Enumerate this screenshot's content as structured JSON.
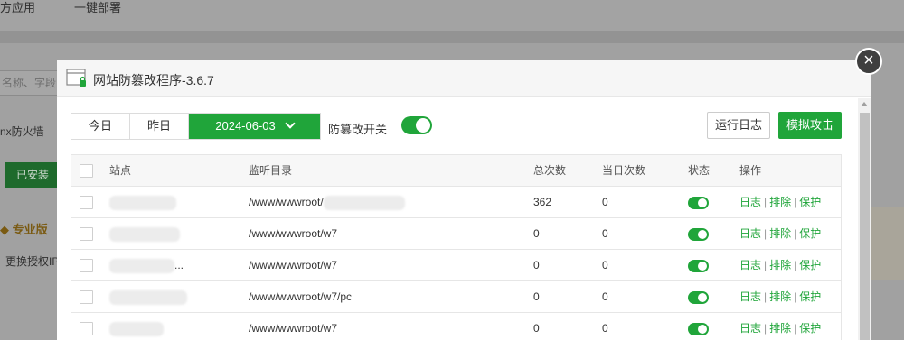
{
  "background": {
    "tabs": [
      "方应用",
      "一键部署"
    ],
    "search_placeholder": "名称、字段",
    "firewall_label": "nx防火墙",
    "installed_label": "已安装",
    "pro_label": "专业版",
    "ip_label": "更换授权IP"
  },
  "dialog": {
    "title": "网站防篡改程序-3.6.7",
    "close_icon": "close-icon",
    "date_buttons": {
      "today": "今日",
      "yesterday": "昨日",
      "selected_date": "2024-06-03"
    },
    "toggle_label": "防篡改开关",
    "toggle_on": true,
    "run_log_label": "运行日志",
    "simulate_attack_label": "模拟攻击",
    "table": {
      "columns": [
        "站点",
        "监听目录",
        "总次数",
        "当日次数",
        "状态",
        "操作"
      ],
      "rows": [
        {
          "site": "",
          "dir": "/www/wwwroot/",
          "total": "362",
          "today": "0",
          "status_on": true
        },
        {
          "site": "",
          "dir": "/www/wwwroot/w7",
          "total": "0",
          "today": "0",
          "status_on": true
        },
        {
          "site": "...",
          "dir": "/www/wwwroot/w7",
          "total": "0",
          "today": "0",
          "status_on": true
        },
        {
          "site": "",
          "dir": "/www/wwwroot/w7/pc",
          "total": "0",
          "today": "0",
          "status_on": true
        },
        {
          "site": "",
          "dir": "/www/wwwroot/w7",
          "total": "0",
          "today": "0",
          "status_on": true
        }
      ],
      "ops": {
        "log": "日志",
        "exclude": "排除",
        "protect": "保护",
        "separator": "|"
      }
    }
  },
  "colors": {
    "accent": "#20a53a",
    "overlay": "#9e9e9e"
  }
}
